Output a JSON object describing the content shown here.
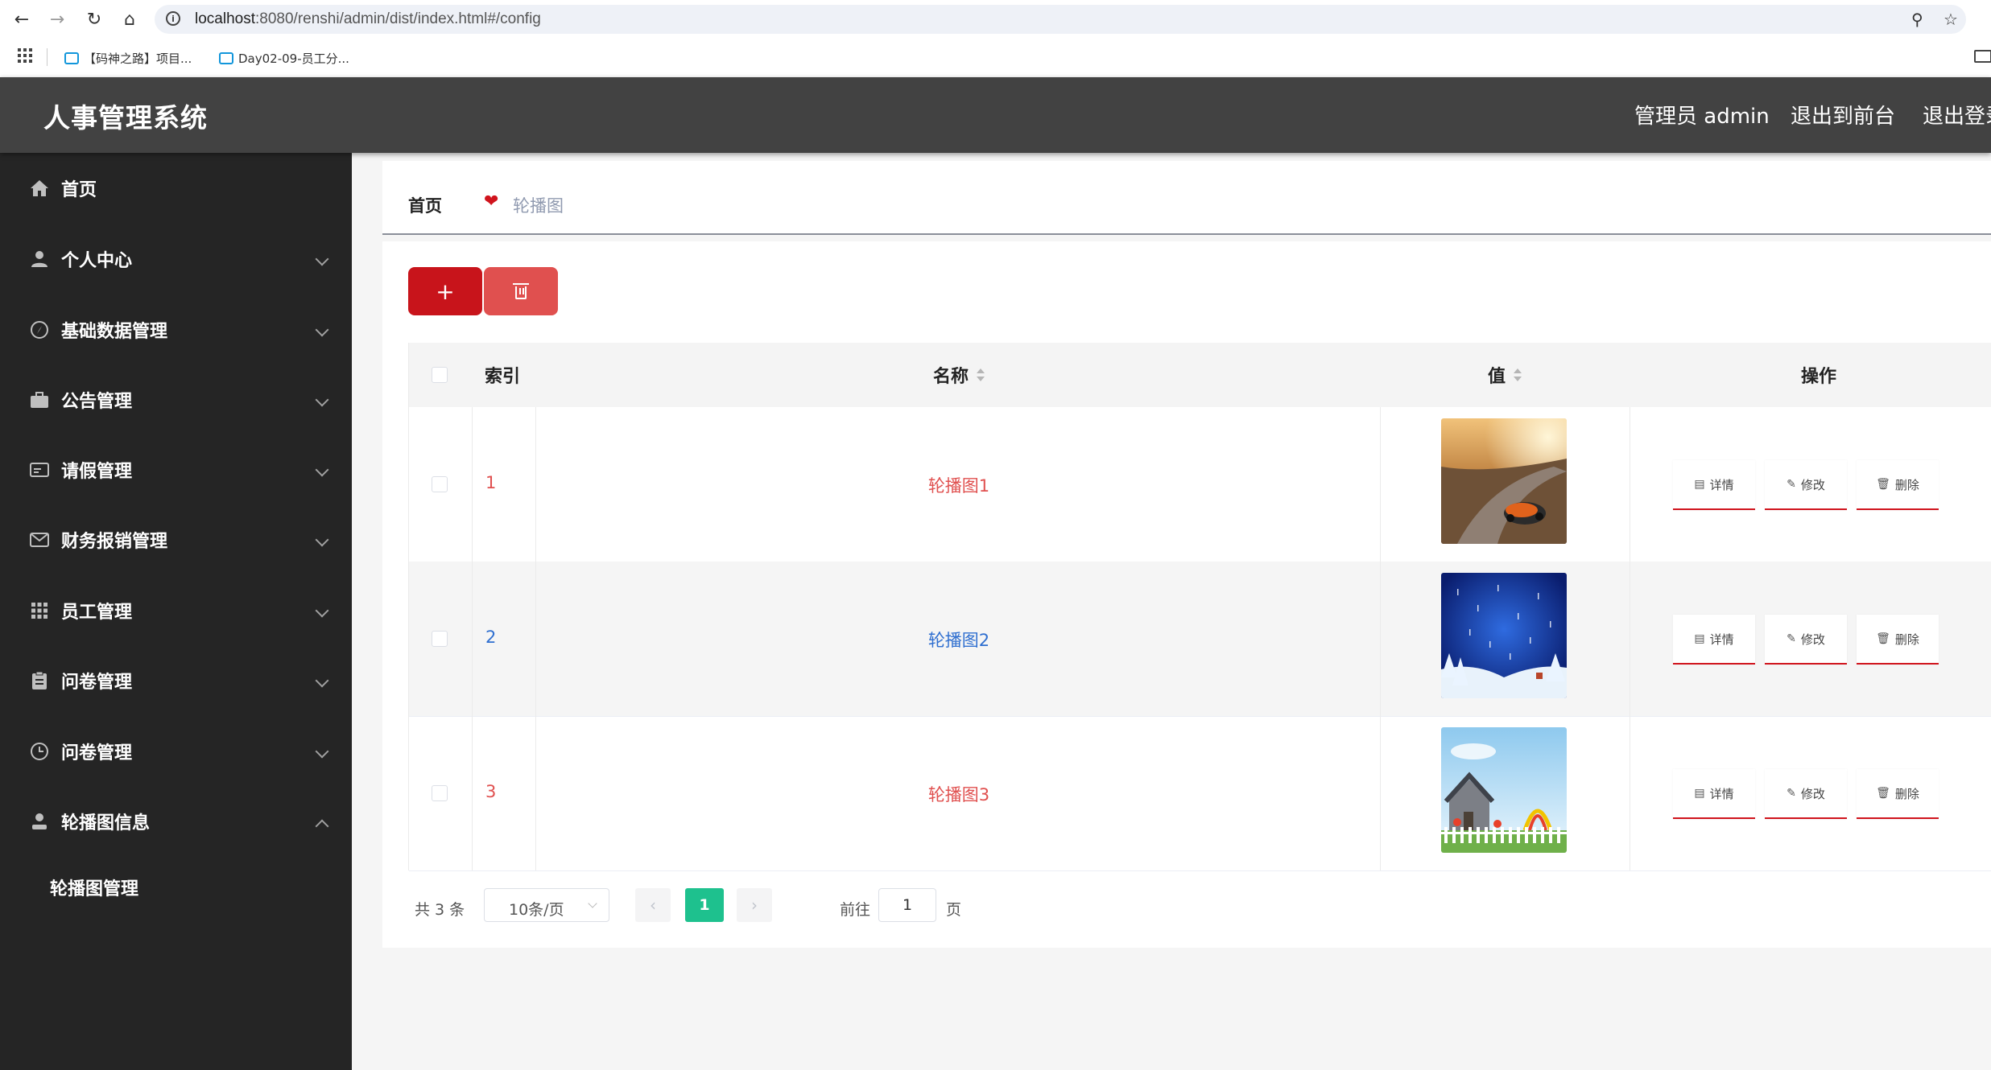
{
  "browser": {
    "url_host": "localhost",
    "url_rest": ":8080/renshi/admin/dist/index.html#/config",
    "bookmarks": [
      "【码神之路】项目...",
      "Day02-09-员工分..."
    ]
  },
  "header": {
    "title": "人事管理系统",
    "user_label": "管理员 admin",
    "to_front": "退出到前台",
    "logout": "退出登录"
  },
  "sidebar": {
    "items": [
      {
        "label": "首页",
        "icon": "home-icon"
      },
      {
        "label": "个人中心",
        "icon": "user-icon"
      },
      {
        "label": "基础数据管理",
        "icon": "compass-icon"
      },
      {
        "label": "公告管理",
        "icon": "briefcase-icon"
      },
      {
        "label": "请假管理",
        "icon": "card-icon"
      },
      {
        "label": "财务报销管理",
        "icon": "mail-icon"
      },
      {
        "label": "员工管理",
        "icon": "grid-icon"
      },
      {
        "label": "问卷管理",
        "icon": "clipboard-icon"
      },
      {
        "label": "问卷管理",
        "icon": "clock-icon"
      },
      {
        "label": "轮播图信息",
        "icon": "person-icon"
      }
    ],
    "sub_item": "轮播图管理"
  },
  "breadcrumb": {
    "home": "首页",
    "current": "轮播图"
  },
  "toolbar": {
    "add_label": "+"
  },
  "table": {
    "headers": {
      "index": "索引",
      "name": "名称",
      "value": "值",
      "actions": "操作"
    },
    "rows": [
      {
        "index": "1",
        "name": "轮播图1",
        "thumb": "race-car"
      },
      {
        "index": "2",
        "name": "轮播图2",
        "thumb": "winter-night"
      },
      {
        "index": "3",
        "name": "轮播图3",
        "thumb": "house-garden"
      }
    ],
    "actions": {
      "detail": "详情",
      "edit": "修改",
      "delete": "删除"
    }
  },
  "pagination": {
    "total": "共 3 条",
    "page_size": "10条/页",
    "current_page": "1",
    "goto_label": "前往",
    "goto_value": "1",
    "page_suffix": "页"
  },
  "colors": {
    "header_bg": "#424242",
    "sidebar_bg": "#252525",
    "primary_red": "#c8141b",
    "danger": "#e0504f",
    "pager_active": "#1ec18e",
    "link_blue": "#2f6fd0"
  }
}
